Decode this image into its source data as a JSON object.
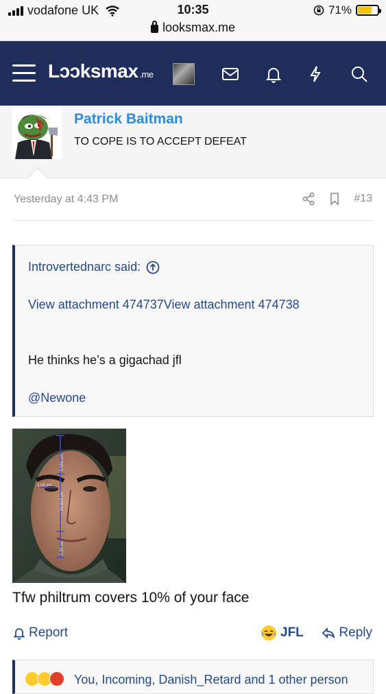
{
  "status_bar": {
    "carrier": "vodafone UK",
    "time": "10:35",
    "battery_percent": "71%",
    "battery_level": 0.71
  },
  "url_bar": {
    "domain": "looksmax.me"
  },
  "header": {
    "logo_text": "Lɔɔksmax",
    "logo_tld": ".me",
    "icons": [
      "menu-icon",
      "avatar",
      "inbox-icon",
      "alerts-icon",
      "whats-new-icon",
      "search-icon"
    ],
    "bg_color": "#1e2d5a"
  },
  "poster": {
    "username": "Patrick Baitman",
    "user_title": "TO COPE IS TO ACCEPT DEFEAT",
    "name_color": "#2c8ce0"
  },
  "post": {
    "date": "Yesterday at 4:43 PM",
    "number": "#13",
    "quote": {
      "author": "Introvertednarc said:",
      "attachments": "View attachment 474737View attachment 474738",
      "text": "He thinks he’s a gigachad jfl",
      "mention": "@Newone"
    },
    "photo_labels": {
      "top": "5.956 cm",
      "middle": "20.813 cm",
      "bottom": "2.25 cm",
      "eye": "3.06 cm"
    },
    "text": "Tfw philtrum covers 10% of your face"
  },
  "actions": {
    "report": "Report",
    "reaction_label": "JFL",
    "reply": "Reply"
  },
  "reactions": {
    "text": "You, Incoming, Danish_Retard and 1 other person"
  }
}
